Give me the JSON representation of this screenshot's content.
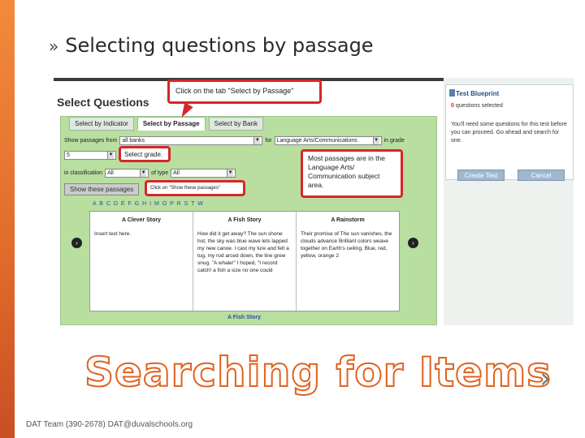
{
  "slide": {
    "title": "Selecting questions by passage",
    "title_bullet": "»",
    "big_heading": "Searching for Items",
    "next_symbol": "›",
    "footer": "DAT Team (390-2678) DAT@duvalschools.org"
  },
  "app": {
    "heading": "Select Questions",
    "tabs": [
      "Select by Indicator",
      "Select by Passage",
      "Select by Bank"
    ],
    "filters": {
      "show_passages_label": "Show passages from",
      "bank_value": "all banks",
      "for_label": "for",
      "subject_value": "Language Arts/Communications",
      "in_grade_label": "in grade",
      "grade_value": "5",
      "classification_label": "in classification",
      "classification_value": "All",
      "type_label": "of type",
      "type_value": "All"
    },
    "show_button": "Show these passages",
    "alphabet": "A B C D E F G H I   M O P R S T W",
    "cards": [
      {
        "title": "A Clever Story",
        "text": "Insert text here."
      },
      {
        "title": "A Fish Story",
        "text": "How did it get away? The sun shone hot, the sky was blue wave lets lapped my new canoe. I cast my lure and felt a tug, my rod arced down, the line grew snug. \"A whale!\" I hoped, \"I record catch! a fish a size no one could"
      },
      {
        "title": "A Rainstorm",
        "text": "Their promise of The sun vanishes, the clouds advance Brilliant colors weave together on Earth's ceiling, Blue, red, yellow, orange 2"
      }
    ],
    "selected_caption": "A Fish Story",
    "nav_prev": "‹",
    "nav_next": "›"
  },
  "callouts": {
    "tab": "Click on the tab \"Select by Passage\"",
    "grade": "Select grade.",
    "show": "Click on \"Show these passages\"",
    "subject": "Most passages are in the Language Arts/ Communication subject area."
  },
  "blueprint": {
    "title": "Test Blueprint",
    "count": "0",
    "count_suffix": "questions selected",
    "message": "You'll need some questions for this test before you can proceed. Go ahead and search for one.",
    "create_button": "Create Test",
    "cancel_button": "Cancel"
  },
  "colors": {
    "accent_orange": "#e0621f",
    "callout_red": "#d8262a",
    "panel_green": "#b8dea0"
  }
}
